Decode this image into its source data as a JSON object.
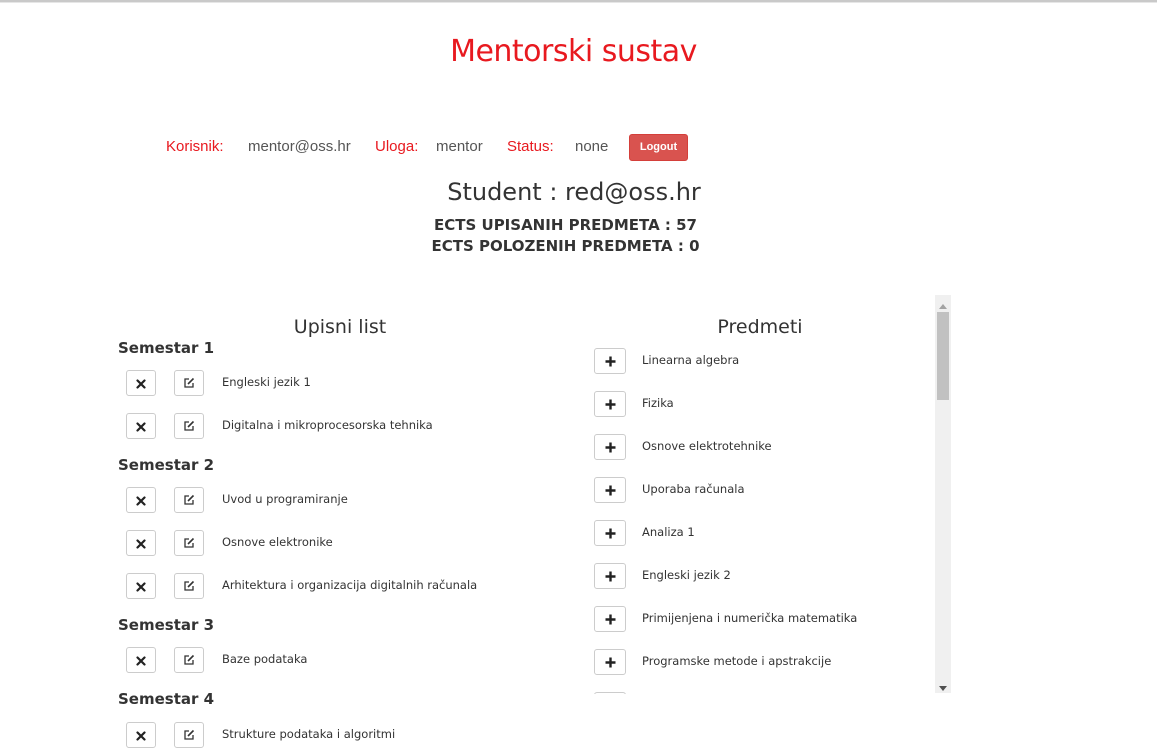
{
  "app": {
    "title": "Mentorski sustav"
  },
  "userbar": {
    "user_label": "Korisnik:",
    "user_value": "mentor@oss.hr",
    "role_label": "Uloga:",
    "role_value": "mentor",
    "status_label": "Status:",
    "status_value": "none",
    "logout_label": "Logout"
  },
  "student": {
    "heading": "Student : red@oss.hr",
    "ects_enrolled": "ECTS UPISANIH PREDMETA : 57",
    "ects_passed": "ECTS POLOZENIH PREDMETA : 0"
  },
  "enrollment": {
    "title": "Upisni list",
    "semesters": [
      {
        "name": "Semestar 1",
        "subjects": [
          "Engleski jezik 1",
          "Digitalna i mikroprocesorska tehnika"
        ]
      },
      {
        "name": "Semestar 2",
        "subjects": [
          "Uvod u programiranje",
          "Osnove elektronike",
          "Arhitektura i organizacija digitalnih računala"
        ]
      },
      {
        "name": "Semestar 3",
        "subjects": [
          "Baze podataka"
        ]
      },
      {
        "name": "Semestar 4",
        "subjects": [
          "Strukture podataka i algoritmi"
        ]
      }
    ]
  },
  "subjects": {
    "title": "Predmeti",
    "items": [
      "Linearna algebra",
      "Fizika",
      "Osnove elektrotehnike",
      "Uporaba računala",
      "Analiza 1",
      "Engleski jezik 2",
      "Primijenjena i numerička matematika",
      "Programske metode i apstrakcije"
    ]
  },
  "icons": {
    "remove": "times-icon",
    "edit": "edit-icon",
    "add": "plus-icon",
    "scroll_up": "triangle-up-icon",
    "scroll_down": "triangle-down-icon"
  },
  "colors": {
    "accent": "#e8191f",
    "logout": "#d9534f"
  }
}
